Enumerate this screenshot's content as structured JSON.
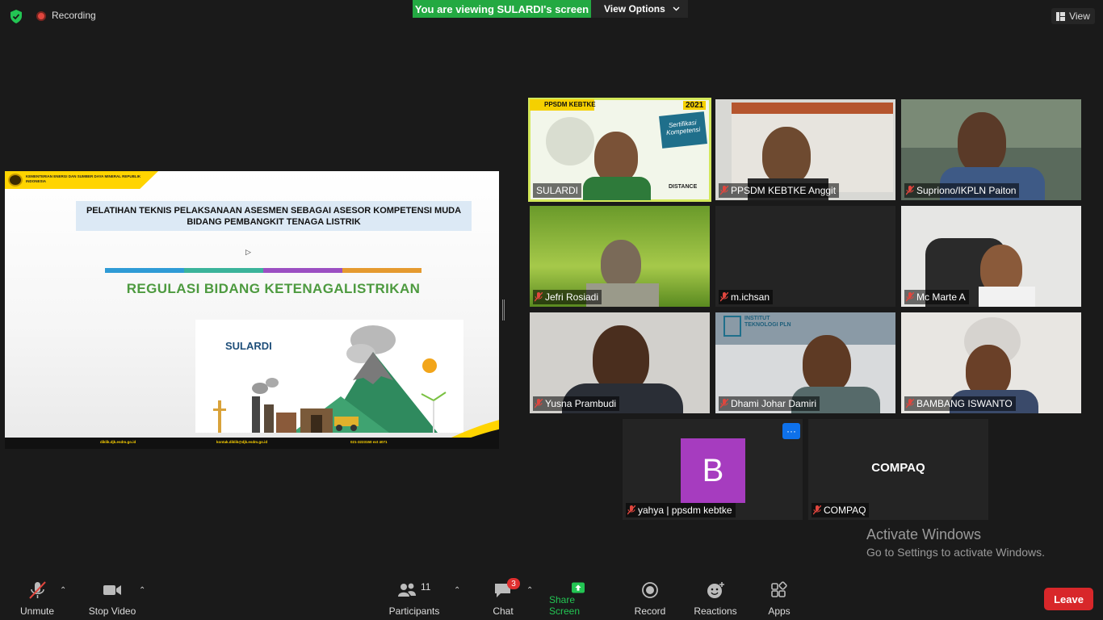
{
  "top_bar": {
    "recording_label": "Recording",
    "viewing_banner": "You are viewing SULARDI's screen",
    "view_options_label": "View Options",
    "view_label": "View"
  },
  "slide": {
    "ministry": "KEMENTERIAN ENERGI DAN SUMBER DAYA MINERAL REPUBLIK INDONESIA",
    "title": "PELATIHAN TEKNIS PELAKSANAAN ASESMEN SEBAGAI ASESOR KOMPETENSI MUDA BIDANG PEMBANGKIT TENAGA LISTRIK",
    "subtitle": "REGULASI BIDANG KETENAGALISTRIKAN",
    "presenter": "SULARDI",
    "footer_web": "diklik.djk.esdm.go.id",
    "footer_email": "kontak.diklik@djk.esdm.go.id",
    "footer_phone": "021-3223150 ext 4071",
    "bar_colors": [
      "#2f9bd6",
      "#3bb39a",
      "#9b4fc2",
      "#e59a2f"
    ]
  },
  "participants": [
    {
      "name": "SULARDI",
      "muted": false,
      "active": true
    },
    {
      "name": "PPSDM KEBTKE Anggit",
      "muted": true
    },
    {
      "name": "Supriono/IKPLN Paiton",
      "muted": true
    },
    {
      "name": "Jefri Rosiadi",
      "muted": true
    },
    {
      "name": "m.ichsan",
      "muted": true
    },
    {
      "name": "Mc Marte A",
      "muted": true
    },
    {
      "name": "Yusna Prambudi",
      "muted": true
    },
    {
      "name": "Dhami Johar Damiri",
      "muted": true
    },
    {
      "name": "BAMBANG ISWANTO",
      "muted": true
    },
    {
      "name": "yahya | ppsdm kebtke",
      "muted": true,
      "avatar_letter": "B"
    },
    {
      "name": "COMPAQ",
      "muted": true,
      "display_text": "COMPAQ"
    }
  ],
  "tile_texts": {
    "sulardi_banner": "PPSDM KEBTKE",
    "sulardi_year": "2021",
    "sulardi_badge": "Sertifikasi Kompetensi",
    "sulardi_distance": "DISTANCE",
    "itpln_label": "INSTITUT TEKNOLOGI PLN",
    "more": "···"
  },
  "watermark": {
    "title": "Activate Windows",
    "subtitle": "Go to Settings to activate Windows."
  },
  "toolbar": {
    "unmute": "Unmute",
    "stop_video": "Stop Video",
    "participants": "Participants",
    "participants_count": "11",
    "chat": "Chat",
    "chat_badge": "3",
    "share_screen": "Share Screen",
    "record": "Record",
    "reactions": "Reactions",
    "apps": "Apps",
    "leave": "Leave"
  },
  "colors": {
    "green_banner": "#23a942",
    "leave": "#d8272a",
    "active_speaker": "#d3e85a",
    "share_green": "#23c553"
  }
}
